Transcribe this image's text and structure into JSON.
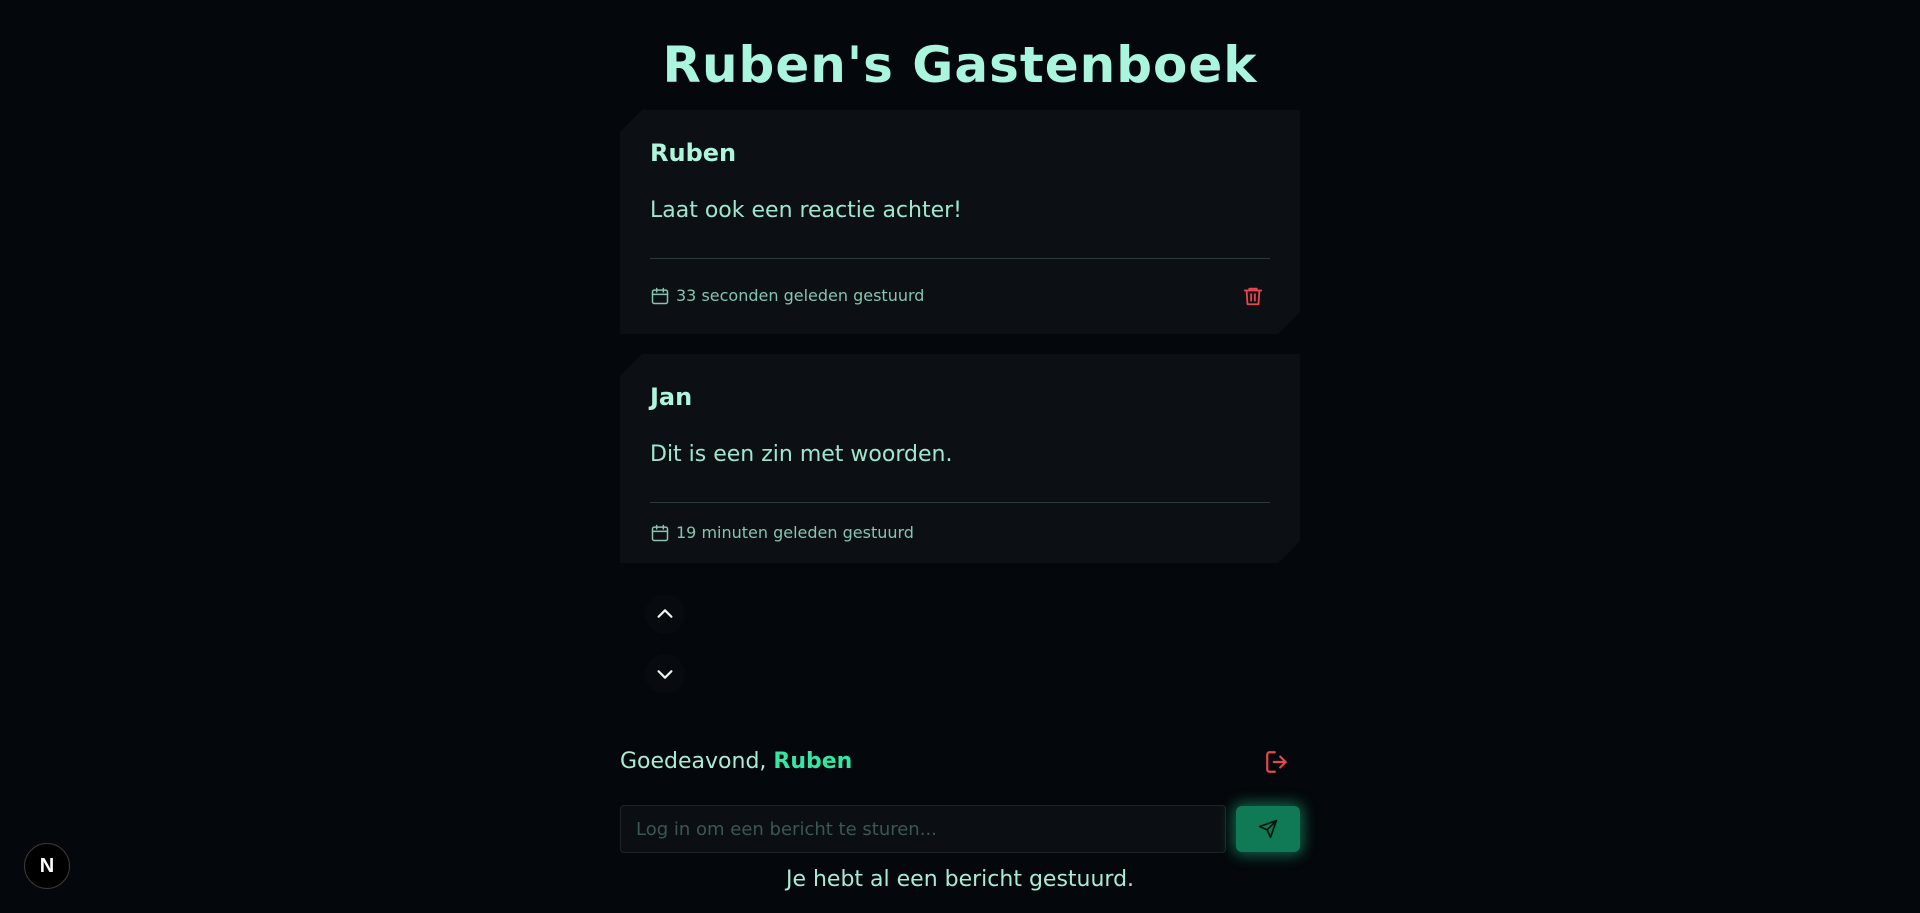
{
  "page": {
    "title": "Ruben's Gastenboek"
  },
  "messages": [
    {
      "author": "Ruben",
      "text": "Laat ook een reactie achter!",
      "timestamp": "33 seconden geleden gestuurd",
      "deletable": true
    },
    {
      "author": "Jan",
      "text": "Dit is een zin met woorden.",
      "timestamp": "19 minuten geleden gestuurd",
      "deletable": false
    }
  ],
  "icons": {
    "calendar": "calendar-icon",
    "delete": "trash-icon",
    "scroll_up": "chevron-up-icon",
    "scroll_down": "chevron-down-icon",
    "logout": "logout-icon",
    "send": "send-icon",
    "framework_badge": "nextjs-icon"
  },
  "greeting": {
    "prefix": "Goedeavond, ",
    "username": "Ruben"
  },
  "composer": {
    "placeholder": "Log in om een bericht te sturen...",
    "value": ""
  },
  "notice": "Je hebt al een bericht gestuurd.",
  "badge": {
    "label": "N"
  },
  "colors": {
    "background": "#04070b",
    "card": "#0c1014",
    "accent": "#33e6a4",
    "title": "#a9f5dd",
    "danger": "#e5484d",
    "send_button": "#0f7a55"
  }
}
